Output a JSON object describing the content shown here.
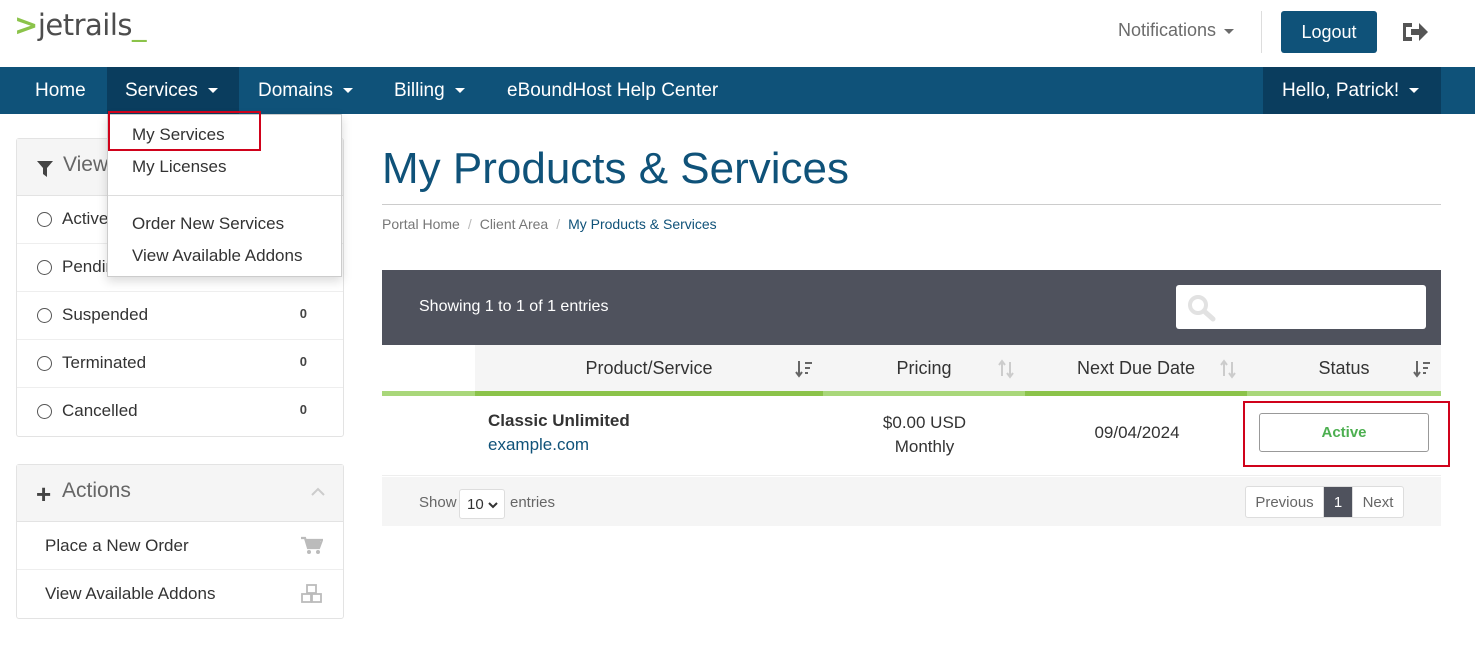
{
  "header": {
    "logo_prefix": ">",
    "logo_name": "jetrails",
    "logo_suffix": "_",
    "notifications_label": "Notifications",
    "logout_label": "Logout"
  },
  "nav": {
    "items": [
      {
        "label": "Home"
      },
      {
        "label": "Services"
      },
      {
        "label": "Domains"
      },
      {
        "label": "Billing"
      },
      {
        "label": "eBoundHost Help Center"
      }
    ],
    "user_label": "Hello, Patrick!"
  },
  "services_menu": {
    "items": [
      "My Services",
      "My Licenses",
      "Order New Services",
      "View Available Addons"
    ]
  },
  "sidebar": {
    "view_title": "View",
    "filters": [
      {
        "label": "Active",
        "count": ""
      },
      {
        "label": "Pending",
        "count": ""
      },
      {
        "label": "Suspended",
        "count": "0"
      },
      {
        "label": "Terminated",
        "count": "0"
      },
      {
        "label": "Cancelled",
        "count": "0"
      }
    ],
    "actions_title": "Actions",
    "actions": [
      {
        "label": "Place a New Order",
        "icon": "cart-icon"
      },
      {
        "label": "View Available Addons",
        "icon": "cubes-icon"
      }
    ]
  },
  "main": {
    "title": "My Products & Services",
    "breadcrumb": [
      "Portal Home",
      "Client Area",
      "My Products & Services"
    ],
    "showing_text": "Showing 1 to 1 of 1 entries",
    "search_placeholder": "",
    "columns": [
      "Product/Service",
      "Pricing",
      "Next Due Date",
      "Status"
    ],
    "rows": [
      {
        "product": "Classic Unlimited",
        "domain": "example.com",
        "price": "$0.00 USD",
        "cycle": "Monthly",
        "next_due": "09/04/2024",
        "status": "Active"
      }
    ],
    "footer": {
      "show_label": "Show",
      "page_length": "10",
      "entries_label": "entries",
      "previous_label": "Previous",
      "current_page": "1",
      "next_label": "Next"
    }
  },
  "colors": {
    "brand_blue": "#0f5279",
    "brand_green": "#8bc34a",
    "status_green": "#4caf50",
    "highlight_red": "#d0021b"
  }
}
